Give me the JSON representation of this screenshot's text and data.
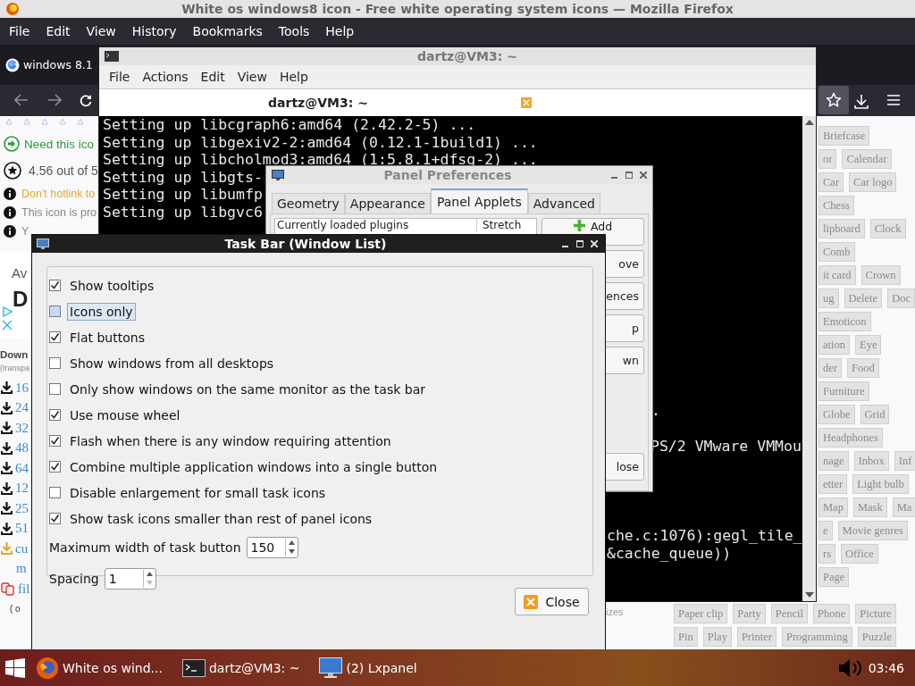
{
  "firefox": {
    "title": "White os windows8 icon - Free white operating system icons — Mozilla Firefox",
    "menu": [
      "File",
      "Edit",
      "View",
      "History",
      "Bookmarks",
      "Tools",
      "Help"
    ],
    "tab": {
      "label": "windows 8.1"
    },
    "info": [
      {
        "kind": "cta",
        "text": "Need this ico"
      },
      {
        "kind": "rating",
        "text": "4.56 out of 5"
      },
      {
        "kind": "warning",
        "text": "Don't hotlink to"
      },
      {
        "kind": "note",
        "text": "This icon is pro"
      },
      {
        "kind": "note",
        "text": "Y"
      }
    ],
    "ad": {
      "line_1": "Av",
      "line_2": "D"
    },
    "downloads": {
      "heading": "Down",
      "subheading": "(transpa",
      "sizes": [
        "16",
        "24",
        "32",
        "48",
        "64",
        "12",
        "25",
        "51"
      ],
      "custom": [
        "cu",
        "m"
      ],
      "file": "fil",
      "other": "( o"
    },
    "tags": [
      [
        "Briefcase"
      ],
      [
        "or",
        "Calendar"
      ],
      [
        "Car",
        "Car logo"
      ],
      [
        "Chess"
      ],
      [
        "lipboard",
        "Clock"
      ],
      [
        "Comb"
      ],
      [
        "it card",
        "Crown"
      ],
      [
        "ug",
        "Delete",
        "Doc"
      ],
      [
        "Emoticon"
      ],
      [
        "ation",
        "Eye"
      ],
      [
        "der",
        "Food"
      ],
      [
        "Furniture"
      ],
      [
        "Globe",
        "Grid"
      ],
      [
        "Headphones"
      ],
      [
        "nage",
        "Inbox",
        "Inf"
      ],
      [
        "etter",
        "Light bulb"
      ],
      [
        "Map",
        "Mask",
        "Ma"
      ],
      [
        "e",
        "Movie genres"
      ],
      [
        "rs",
        "Office"
      ],
      [
        "Page"
      ]
    ],
    "bottom_note": "izes",
    "bottom_tags": [
      [
        "Paper clip",
        "Party",
        "Pencil",
        "Phone",
        "Picture"
      ],
      [
        "Pin",
        "Play",
        "Printer",
        "Programming",
        "Puzzle"
      ]
    ]
  },
  "terminal": {
    "title": "dartz@VM3: ~",
    "menu": [
      "File",
      "Actions",
      "Edit",
      "View",
      "Help"
    ],
    "tab": "dartz@VM3: ~",
    "lines": [
      "Setting up libcgraph6:amd64 (2.42.2-5) ...",
      "Setting up libgexiv2-2:amd64 (0.12.1-1build1) ...",
      "Setting up libcholmod3:amd64 (1:5.8.1+dfsg-2) ...",
      "Setting up libgts-",
      "Setting up libumfp",
      "Setting up libgvc6"
    ],
    "fragments": [
      ".",
      "PS/2 VMware VMMou",
      "che.c:1076):gegl_tile_",
      "&cache_queue))"
    ]
  },
  "panel_preferences": {
    "title": "Panel Preferences",
    "tabs": [
      {
        "label": "Geometry",
        "selected": false
      },
      {
        "label": "Appearance",
        "selected": false
      },
      {
        "label": "Panel Applets",
        "selected": true
      },
      {
        "label": "Advanced",
        "selected": false
      }
    ],
    "columns": [
      "Currently loaded plugins",
      "Stretch"
    ],
    "buttons": [
      {
        "kind": "add",
        "label": "Add"
      },
      {
        "kind": "plain",
        "label": "ove"
      },
      {
        "kind": "plain",
        "label": "ences"
      },
      {
        "kind": "plain",
        "label": "p"
      },
      {
        "kind": "plain",
        "label": "wn"
      },
      {
        "kind": "close",
        "label": "lose"
      }
    ]
  },
  "task_bar_dialog": {
    "title": "Task Bar (Window List)",
    "options": [
      {
        "label": "Show tooltips",
        "checked": true,
        "focused": false
      },
      {
        "label": "Icons only",
        "checked": false,
        "focused": true
      },
      {
        "label": "Flat buttons",
        "checked": true,
        "focused": false
      },
      {
        "label": "Show windows from all desktops",
        "checked": false,
        "focused": false
      },
      {
        "label": "Only show windows on the same monitor as the task bar",
        "checked": false,
        "focused": false
      },
      {
        "label": "Use mouse wheel",
        "checked": true,
        "focused": false
      },
      {
        "label": "Flash when there is any window requiring attention",
        "checked": true,
        "focused": false
      },
      {
        "label": "Combine multiple application windows into a single button",
        "checked": true,
        "focused": false
      },
      {
        "label": "Disable enlargement for small task icons",
        "checked": false,
        "focused": false
      },
      {
        "label": "Show task icons smaller than rest of panel icons",
        "checked": true,
        "focused": false
      }
    ],
    "spinners": [
      {
        "label": "Maximum width of task button",
        "value": "150"
      },
      {
        "label": "Spacing",
        "value": "1"
      }
    ],
    "close": "Close"
  },
  "taskbar": {
    "items": [
      {
        "kind": "browser",
        "label": "White os wind..."
      },
      {
        "kind": "terminal",
        "label": "dartz@VM3: ~"
      },
      {
        "kind": "monitor",
        "label": "(2) Lxpanel"
      }
    ],
    "clock": "03:46"
  }
}
